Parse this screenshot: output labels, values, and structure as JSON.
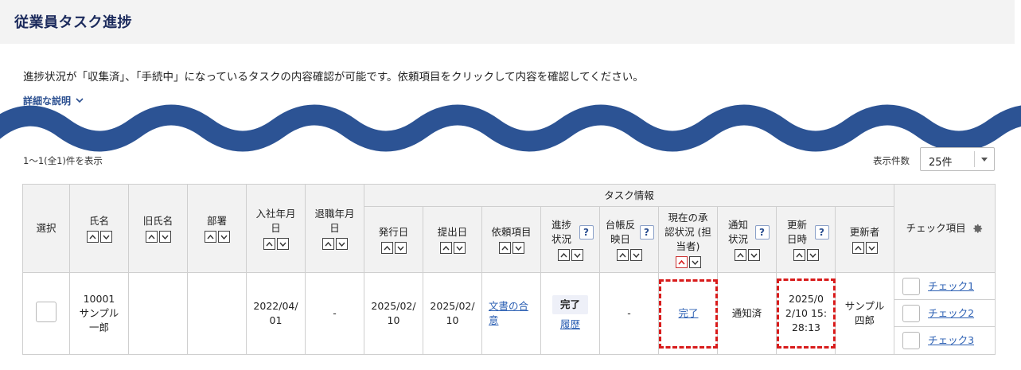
{
  "page_title": "従業員タスク進捗",
  "description": "進捗状況が「収集済」、「手続中」になっているタスクの内容確認が可能です。依頼項目をクリックして内容を確認してください。",
  "detail_link": "詳細な説明",
  "result_count": "1～1(全1)件を表示",
  "per_page": {
    "label": "表示件数",
    "value": "25件"
  },
  "table": {
    "group_header": "タスク情報",
    "headers": {
      "select": "選択",
      "name": "氏名",
      "former_name": "旧氏名",
      "department": "部署",
      "hire_date": "入社年月日",
      "leave_date": "退職年月日",
      "issue_date": "発行日",
      "submit_date": "提出日",
      "request_item": "依頼項目",
      "progress": "進捗状況",
      "ledger_date": "台帳反映日",
      "approval": "現在の承認状況 (担当者)",
      "notify": "通知状況",
      "updated_at": "更新日時",
      "updated_by": "更新者",
      "check_items": "チェック項目"
    },
    "help_mark": "?",
    "row": {
      "employee_id": "10001",
      "name": "サンプル一郎",
      "former_name": "",
      "department": "",
      "hire_date": "2022/04/01",
      "leave_date": "-",
      "issue_date": "2025/02/10",
      "submit_date": "2025/02/10",
      "request_item": "文書の合意",
      "progress_status": "完了",
      "progress_history": "履歴",
      "ledger_date": "-",
      "approval": "完了",
      "notify": "通知済",
      "updated_at": "2025/02/10 15:28:13",
      "updated_by": "サンプル四郎",
      "checks": [
        "チェック1",
        "チェック2",
        "チェック3"
      ]
    }
  },
  "colors": {
    "title": "#1b2a5c",
    "link": "#2b5fb3",
    "highlight": "#d81b1b",
    "wave": "#2c5394"
  }
}
